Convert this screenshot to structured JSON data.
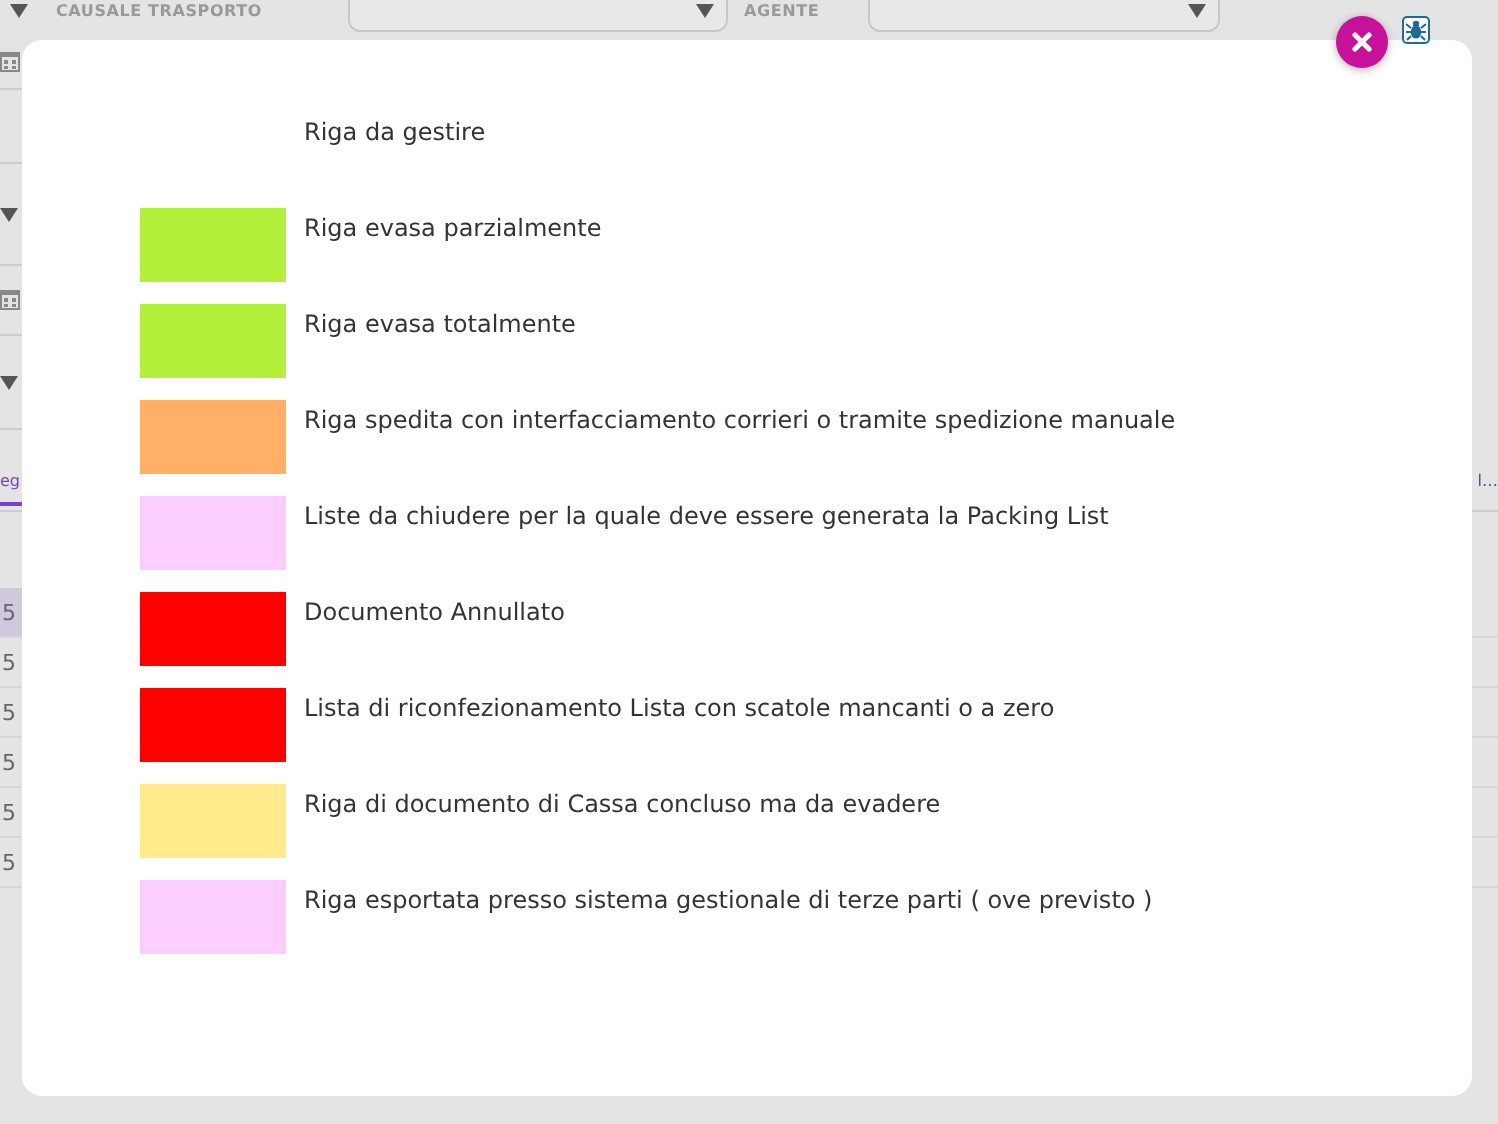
{
  "background": {
    "fields": [
      {
        "label": "CAUSALE TRASPORTO"
      },
      {
        "label": "AGENTE"
      }
    ],
    "tab": {
      "label": "eg",
      "selected": true
    },
    "header_text": "l…",
    "rows": [
      {
        "cell": "5",
        "selected": true
      },
      {
        "cell": "5",
        "selected": false
      },
      {
        "cell": "5",
        "selected": false
      },
      {
        "cell": "5",
        "selected": false
      },
      {
        "cell": "5",
        "selected": false
      },
      {
        "cell": "5",
        "selected": false
      }
    ]
  },
  "legend": {
    "items": [
      {
        "label": "Riga da gestire"
      },
      {
        "label": "Riga evasa parzialmente",
        "color": "#b3f03c"
      },
      {
        "label": "Riga evasa totalmente",
        "color": "#b3f03c"
      },
      {
        "label": "Riga spedita con interfacciamento corrieri o tramite spedizione manuale",
        "color": "#ffb066"
      },
      {
        "label": "Liste da chiudere per la quale deve essere generata la Packing List",
        "color": "#fccdff"
      },
      {
        "label": "Documento Annullato",
        "color": "#ff0000"
      },
      {
        "label": "Lista di riconfezionamento Lista con scatole mancanti o a zero",
        "color": "#ff0000"
      },
      {
        "label": "Riga di documento di Cassa concluso ma da evadere",
        "color": "#ffea8c"
      },
      {
        "label": "Riga esportata presso sistema gestionale di terze parti ( ove previsto )",
        "color": "#fccdff"
      }
    ]
  }
}
